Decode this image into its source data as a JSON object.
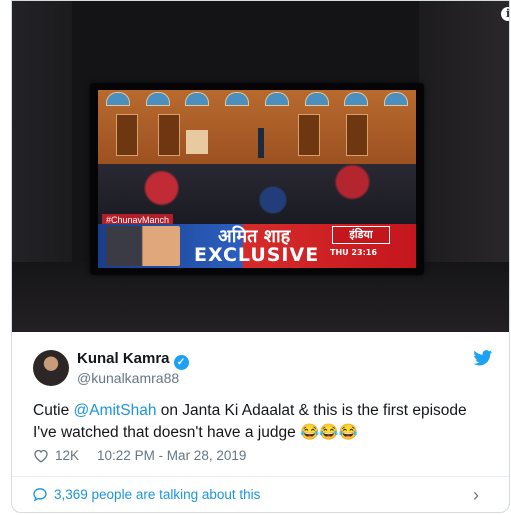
{
  "author": {
    "name": "Kunal Kamra",
    "handle": "@kunalkamra88"
  },
  "tweet": {
    "prefix": "Cutie ",
    "mention": "@AmitShah",
    "rest": " on Janta Ki Adaalat & this is the first episode I've watched that doesn't have a judge ",
    "emojis": "😂😂😂"
  },
  "media": {
    "hashtag": "#ChunavManch",
    "headline_hindi": "अमित शाह",
    "headline": "EXCLUSIVE",
    "channel": "इंडिया",
    "clock": "THU 23:16"
  },
  "meta": {
    "likes": "12K",
    "timestamp": "10:22 PM - Mar 28, 2019"
  },
  "footer": {
    "talking": "3,369 people are talking about this"
  },
  "colors": {
    "link": "#1b95e0",
    "verified": "#1da1f2",
    "text": "#14171a",
    "secondary": "#657786"
  },
  "icons": {
    "info": "info-icon",
    "verified": "verified-badge-icon",
    "twitter": "twitter-bird-icon",
    "like": "heart-icon",
    "comment": "comment-bubble-icon",
    "chevron": "chevron-right-icon"
  }
}
